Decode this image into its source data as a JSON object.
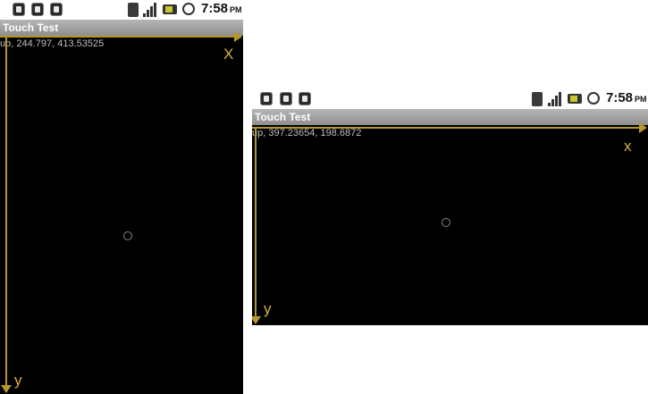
{
  "screens": [
    {
      "orientation": "portrait",
      "status": {
        "time": "7:58",
        "ampm": "PM"
      },
      "title": "Touch Test",
      "readout": "up, 244.797, 413.53525",
      "axis_labels": {
        "x": "X",
        "y": "y"
      }
    },
    {
      "orientation": "landscape",
      "status": {
        "time": "7:58",
        "ampm": "PM"
      },
      "title": "Touch Test",
      "readout": "up, 397.23654, 198.6872",
      "axis_labels": {
        "x": "x",
        "y": "y"
      }
    }
  ],
  "colors": {
    "axis": "#b8962e",
    "background": "#000000",
    "titlebar": "#9e9e9e"
  },
  "icons": [
    "lock-icon",
    "usb-icon",
    "sd-card-icon",
    "wifi-icon",
    "signal-icon",
    "battery-icon",
    "alarm-icon"
  ]
}
